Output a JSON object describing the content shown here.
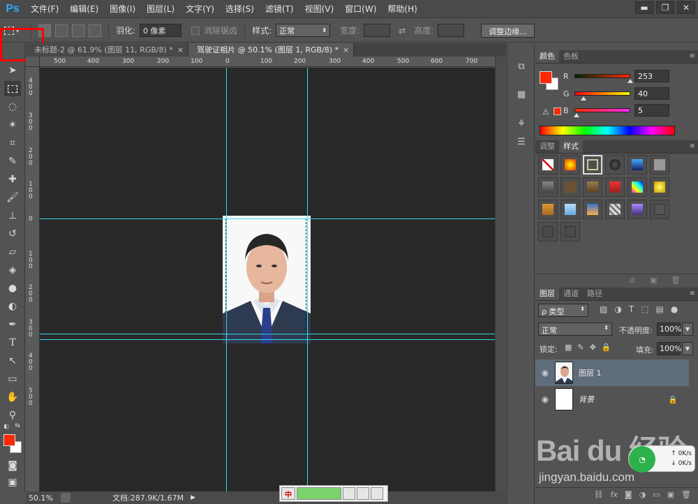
{
  "app": {
    "logo": "Ps"
  },
  "menu": [
    "文件(F)",
    "编辑(E)",
    "图像(I)",
    "图层(L)",
    "文字(Y)",
    "选择(S)",
    "滤镜(T)",
    "视图(V)",
    "窗口(W)",
    "帮助(H)"
  ],
  "window_controls": {
    "minimize": "▬",
    "restore": "❐",
    "close": "✕"
  },
  "options": {
    "feather_label": "羽化:",
    "feather_value": "0 像素",
    "antialias_label": "消除锯齿",
    "style_label": "样式:",
    "style_value": "正常",
    "width_label": "宽度:",
    "height_label": "高度:",
    "refine_button": "调整边缘..."
  },
  "tabs": [
    {
      "label": "未标题-2 @ 61.9% (图层 11, RGB/8) *",
      "close": "×"
    },
    {
      "label": "驾驶证相片 @ 50.1% (图层 1, RGB/8) *",
      "close": "×"
    }
  ],
  "ruler": {
    "h_ticks": [
      "500",
      "400",
      "300",
      "200",
      "100",
      "0",
      "100",
      "200",
      "300",
      "400",
      "500",
      "600",
      "700"
    ],
    "v_ticks": [
      "400",
      "300",
      "200",
      "100",
      "0",
      "100",
      "200",
      "300",
      "400",
      "500"
    ]
  },
  "status": {
    "zoom": "50.1%",
    "doc_info": "文档:287.9K/1.67M"
  },
  "color_panel": {
    "tabs": [
      "颜色",
      "色板"
    ],
    "fg_color": "#fd2805",
    "bg_color": "#ffffff",
    "r_label": "R",
    "r_value": "253",
    "g_label": "G",
    "g_value": "40",
    "b_label": "B",
    "b_value": "5"
  },
  "styles_panel": {
    "tabs": [
      "调整",
      "样式"
    ]
  },
  "layers_panel": {
    "tabs": [
      "图层",
      "通道",
      "路径"
    ],
    "filter_label": "ρ 类型",
    "blend_mode": "正常",
    "opacity_label": "不透明度:",
    "opacity_value": "100%",
    "lock_label": "锁定:",
    "fill_label": "填充:",
    "fill_value": "100%",
    "layers": [
      {
        "name": "图层 1",
        "visible_icon": "👁"
      },
      {
        "name": "背景",
        "visible_icon": "👁"
      }
    ],
    "footer_fx": "fx"
  },
  "taskbar_widget": {
    "label": "中"
  },
  "net_widget": {
    "up": "↑ 0K/s",
    "down": "↓ 0K/s"
  },
  "watermark": {
    "logo": "Bai du 经验",
    "url": "jingyan.baidu.com"
  }
}
